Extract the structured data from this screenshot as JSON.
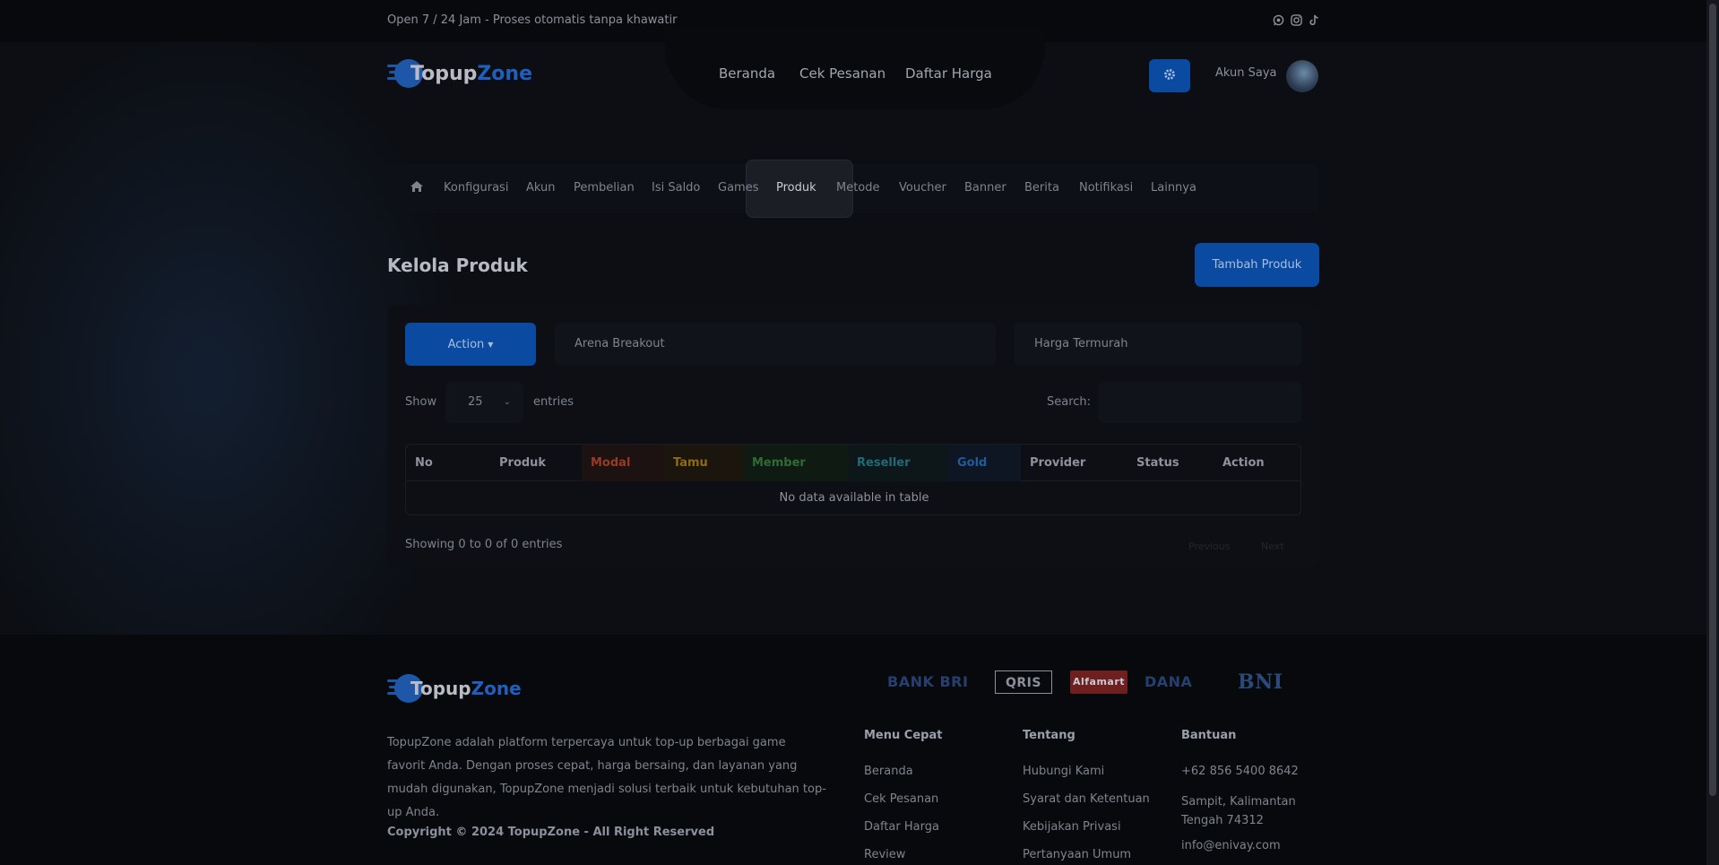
{
  "topbar": {
    "text": "Open 7 / 24 Jam - Proses otomatis tanpa khawatir",
    "social_icons": [
      "whatsapp-icon",
      "instagram-icon",
      "tiktok-icon"
    ]
  },
  "brand": {
    "logo_main": "Topup",
    "logo_accent": "Zone",
    "accent_color": "#1f5fbf"
  },
  "main_nav": [
    "Beranda",
    "Cek Pesanan",
    "Daftar Harga"
  ],
  "header": {
    "account_label": "Akun Saya",
    "settings_icon": "gear-icon"
  },
  "admin_menu": {
    "home_icon": "home-icon",
    "items": [
      "Konfigurasi",
      "Akun",
      "Pembelian",
      "Isi Saldo",
      "Games",
      "Produk",
      "Metode",
      "Voucher",
      "Banner",
      "Berita",
      "Notifikasi",
      "Lainnya"
    ],
    "active": "Produk"
  },
  "page": {
    "title": "Kelola Produk",
    "add_button": "Tambah Produk"
  },
  "filters": {
    "action_button": "Action",
    "game_value": "Arena Breakout",
    "sort_value": "Harga Termurah"
  },
  "table_controls": {
    "show_label": "Show",
    "entries_value": "25",
    "entries_label": "entries",
    "search_label": "Search:"
  },
  "table": {
    "columns": [
      "No",
      "Produk",
      "Modal",
      "Tamu",
      "Member",
      "Reseller",
      "Gold",
      "Provider",
      "Status",
      "Action"
    ],
    "empty_message": "No data available in table"
  },
  "pagination": {
    "info": "Showing 0 to 0 of 0 entries",
    "previous": "Previous",
    "next": "Next"
  },
  "footer": {
    "description": "TopupZone adalah platform terpercaya untuk top-up berbagai game favorit Anda. Dengan proses cepat, harga bersaing, dan layanan yang mudah digunakan, TopupZone menjadi solusi terbaik untuk kebutuhan top-up Anda.",
    "copyright": "Copyright © 2024 TopupZone - All Right Reserved",
    "payment_logos": [
      "BANK BRI",
      "QRIS",
      "Alfamart",
      "DANA",
      "BNI"
    ],
    "columns": [
      {
        "title": "Menu Cepat",
        "links": [
          "Beranda",
          "Cek Pesanan",
          "Daftar Harga",
          "Review"
        ]
      },
      {
        "title": "Tentang",
        "links": [
          "Hubungi Kami",
          "Syarat dan Ketentuan",
          "Kebijakan Privasi",
          "Pertanyaan Umum"
        ]
      },
      {
        "title": "Bantuan",
        "links": [
          "+62 856 5400 8642",
          "Sampit, Kalimantan Tengah 74312",
          "info@enivay.com"
        ]
      }
    ]
  }
}
